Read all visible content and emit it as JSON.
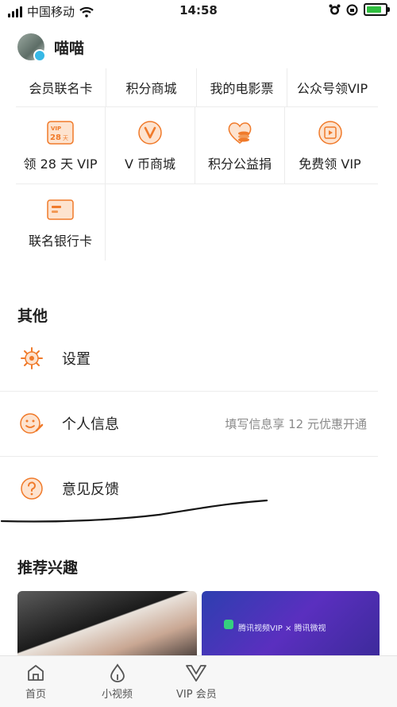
{
  "status_bar": {
    "carrier": "中国移动",
    "time": "14:58"
  },
  "user": {
    "name": "喵喵"
  },
  "grid": {
    "row1": [
      "会员联名卡",
      "积分商城",
      "我的电影票",
      "公众号领VIP"
    ],
    "row2": [
      {
        "label": "领 28 天 VIP",
        "icon": "vip-28-day-icon",
        "icon_text": "VIP 28天"
      },
      {
        "label": "V 币商城",
        "icon": "v-coin-icon",
        "icon_text": "V"
      },
      {
        "label": "积分公益捐",
        "icon": "heart-coin-icon"
      },
      {
        "label": "免费领 VIP",
        "icon": "film-play-icon"
      }
    ],
    "row3": [
      {
        "label": "联名银行卡",
        "icon": "bank-card-icon"
      }
    ]
  },
  "other": {
    "title": "其他",
    "items": [
      {
        "label": "设置",
        "icon": "gear-icon"
      },
      {
        "label": "个人信息",
        "icon": "smile-edit-icon",
        "hint": "填写信息享 12 元优惠开通"
      },
      {
        "label": "意见反馈",
        "icon": "question-icon"
      }
    ]
  },
  "recommend": {
    "title": "推荐兴趣",
    "card2_text": "腾讯视频VIP × 腾讯微视"
  },
  "tabs": [
    {
      "label": "首页",
      "icon": "home-icon"
    },
    {
      "label": "小视频",
      "icon": "drop-icon"
    },
    {
      "label": "VIP 会员",
      "icon": "vip-v-icon"
    }
  ],
  "colors": {
    "accent": "#f07a2a",
    "accent_light": "#fde3cf"
  }
}
